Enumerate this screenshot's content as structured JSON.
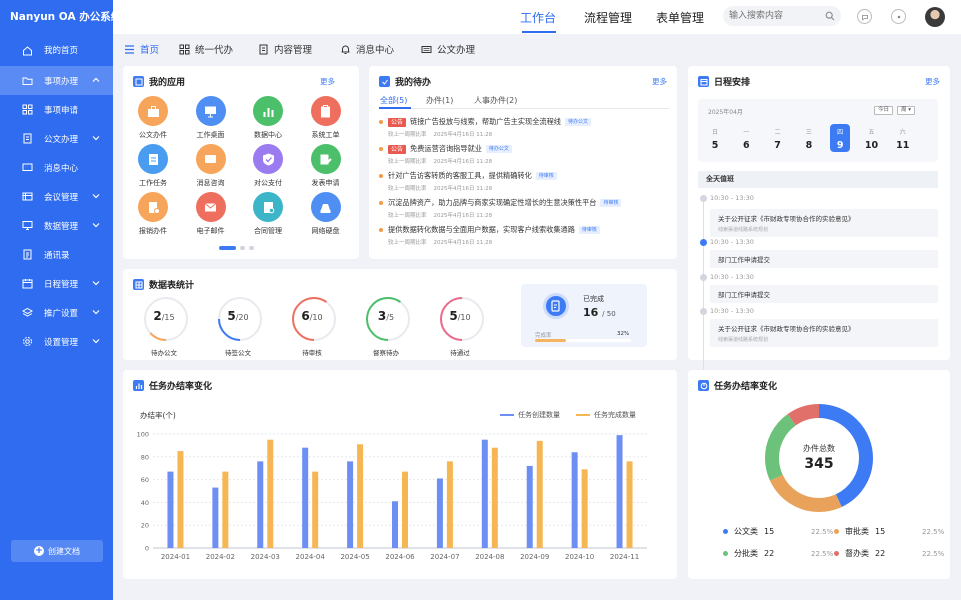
{
  "app": {
    "logo": "Nanyun OA 办公系统"
  },
  "sidebar": {
    "items": [
      {
        "label": "我的首页",
        "icon": "home-icon"
      },
      {
        "label": "事项办理",
        "icon": "folder-icon",
        "expanded": true
      },
      {
        "label": "事项申请",
        "icon": "grid-icon"
      },
      {
        "label": "公文办理",
        "icon": "document-icon"
      },
      {
        "label": "消息中心",
        "icon": "message-icon"
      },
      {
        "label": "会议管理",
        "icon": "meeting-icon"
      },
      {
        "label": "数据管理",
        "icon": "monitor-icon"
      },
      {
        "label": "通讯录",
        "icon": "contacts-icon"
      },
      {
        "label": "日程管理",
        "icon": "calendar-icon"
      },
      {
        "label": "推广设置",
        "icon": "layers-icon"
      },
      {
        "label": "设置管理",
        "icon": "settings-icon"
      }
    ],
    "create_label": "创建文档"
  },
  "topbar": {
    "tabs": [
      "工作台",
      "流程管理",
      "表单管理"
    ],
    "active_tab": 0,
    "search_placeholder": "输入搜索内容"
  },
  "subnav": {
    "items": [
      "首页",
      "统一代办",
      "内容管理",
      "消息中心",
      "公文办理"
    ],
    "active": 0
  },
  "my_apps": {
    "title": "我的应用",
    "more": "更多",
    "apps": [
      {
        "label": "公文办件",
        "color": "#f6a55a",
        "icon": "briefcase-icon"
      },
      {
        "label": "工作桌面",
        "color": "#4f8ef2",
        "icon": "desktop-icon"
      },
      {
        "label": "数据中心",
        "color": "#4cbf6a",
        "icon": "chart-icon"
      },
      {
        "label": "系统工单",
        "color": "#ef6f5e",
        "icon": "clipboard-icon"
      },
      {
        "label": "工作任务",
        "color": "#4a9cf0",
        "icon": "task-icon"
      },
      {
        "label": "消息咨询",
        "color": "#f6a55a",
        "icon": "chat-icon"
      },
      {
        "label": "对公支付",
        "color": "#9b7bf0",
        "icon": "shield-icon"
      },
      {
        "label": "发表申请",
        "color": "#4cbf6a",
        "icon": "edit-icon"
      },
      {
        "label": "报销办件",
        "color": "#f6a55a",
        "icon": "receipt-icon"
      },
      {
        "label": "电子邮件",
        "color": "#ef6f5e",
        "icon": "mail-icon"
      },
      {
        "label": "合同管理",
        "color": "#3cb5c9",
        "icon": "contract-icon"
      },
      {
        "label": "网络硬盘",
        "color": "#4f8ef2",
        "icon": "disk-icon"
      }
    ]
  },
  "todos": {
    "title": "我的待办",
    "more": "更多",
    "tabs": [
      "全部(5)",
      "办件(1)",
      "人事办件(2)"
    ],
    "items": [
      {
        "tag": "公告",
        "text": "链接广告投放与线索，帮助广告主实现全流程线",
        "badge": "待办公文",
        "meta": "较上一周期比率",
        "date": "2025年4月16日  11:28"
      },
      {
        "tag": "公告",
        "text": "免费运营咨询指导就业",
        "badge": "待办公文",
        "meta": "较上一周期比率",
        "date": "2025年4月16日  11:28"
      },
      {
        "tag": "",
        "text": "针对广告访客转质的客服工具，提供精确转化",
        "badge": "待审核",
        "meta": "较上一周期比率",
        "date": "2025年4月16日  11:28"
      },
      {
        "tag": "",
        "text": "沉淀品牌资产，助力品牌与商家实现确定性增长的生意决策性平台",
        "badge": "待审核",
        "meta": "较上一周期比率",
        "date": "2025年4月16日  11:28"
      },
      {
        "tag": "",
        "text": "提供数据转化数据与全面用户数据，实现客户线索收集通路",
        "badge": "待审核",
        "meta": "较上一周期比率",
        "date": "2025年4月16日  11:28"
      }
    ]
  },
  "schedule": {
    "title": "日程安排",
    "more": "更多",
    "month": "2025年04月",
    "today_btn": "今日",
    "view_btn": "周",
    "days": [
      {
        "w": "日",
        "d": "5"
      },
      {
        "w": "一",
        "d": "6"
      },
      {
        "w": "二",
        "d": "7"
      },
      {
        "w": "三",
        "d": "8"
      },
      {
        "w": "四",
        "d": "9",
        "selected": true
      },
      {
        "w": "五",
        "d": "10"
      },
      {
        "w": "六",
        "d": "11"
      }
    ],
    "all_day": "全天值班",
    "events": [
      {
        "time": "10:30 - 13:30",
        "title": "",
        "sub": ""
      },
      {
        "time": "",
        "title": "关于公开征求《市财政专项协合作的实验意见》",
        "sub": "线索渠道线路系统规划"
      },
      {
        "time": "10:30 - 13:30",
        "title": "",
        "sub": ""
      },
      {
        "time": "",
        "title": "部门工作申请提交",
        "sub": ""
      },
      {
        "time": "10:30 - 13:30",
        "title": "",
        "sub": ""
      },
      {
        "time": "",
        "title": "部门工作申请提交",
        "sub": ""
      },
      {
        "time": "10:30 - 13:30",
        "title": "",
        "sub": ""
      },
      {
        "time": "",
        "title": "关于公开征求《市财政专项协合作的实验意见》",
        "sub": "线索渠道线路系统规划"
      }
    ]
  },
  "stats": {
    "title": "数据表统计",
    "items": [
      {
        "value": "2",
        "total": "/15",
        "label": "待办公文",
        "frac": 0.133,
        "color": "#f6a55a"
      },
      {
        "value": "5",
        "total": "/20",
        "label": "待签公文",
        "frac": 0.25,
        "color": "#3d7bf5"
      },
      {
        "value": "6",
        "total": "/10",
        "label": "待审核",
        "frac": 0.6,
        "color": "#ef6f5e"
      },
      {
        "value": "3",
        "total": "/5",
        "label": "督察待办",
        "frac": 0.6,
        "color": "#4cbf6a"
      },
      {
        "value": "5",
        "total": "/10",
        "label": "待通过",
        "frac": 0.5,
        "color": "#e96b8c"
      }
    ],
    "done": {
      "label": "已完成",
      "value": "16",
      "total": "/ 50",
      "progress_label": "完成率",
      "percent_text": "32%",
      "percent": 0.32
    }
  },
  "task_chart": {
    "title": "任务办结率变化",
    "legend": [
      "任务创建数量",
      "任务完成数量"
    ],
    "colors": [
      "#6d8ff3",
      "#f6b653"
    ]
  },
  "chart_data": {
    "type": "bar",
    "ylabel": "办结率(个)",
    "ylim": [
      0,
      100
    ],
    "yticks": [
      0,
      20,
      40,
      60,
      80,
      100
    ],
    "categories": [
      "2024-01",
      "2024-02",
      "2024-03",
      "2024-04",
      "2024-05",
      "2024-06",
      "2024-07",
      "2024-08",
      "2024-09",
      "2024-10",
      "2024-11"
    ],
    "series": [
      {
        "name": "任务创建数量",
        "values": [
          67,
          53,
          76,
          88,
          76,
          41,
          61,
          95,
          72,
          84,
          99
        ]
      },
      {
        "name": "任务完成数量",
        "values": [
          85,
          67,
          95,
          67,
          91,
          67,
          76,
          88,
          94,
          69,
          76
        ]
      }
    ]
  },
  "pie_card": {
    "title": "任务办结率变化",
    "center_label": "办件总数",
    "center_value": "345",
    "legend": [
      {
        "name": "公文类",
        "value": "15",
        "pct": "22.5%",
        "color": "#3d7bf5"
      },
      {
        "name": "审批类",
        "value": "15",
        "pct": "22.5%",
        "color": "#e8a25a"
      },
      {
        "name": "分批类",
        "value": "22",
        "pct": "22.5%",
        "color": "#6cc27a"
      },
      {
        "name": "督办类",
        "value": "22",
        "pct": "22.5%",
        "color": "#e2706a"
      }
    ],
    "segments": [
      {
        "color": "#3d7bf5",
        "frac": 0.43
      },
      {
        "color": "#e8a25a",
        "frac": 0.25
      },
      {
        "color": "#6cc27a",
        "frac": 0.22
      },
      {
        "color": "#e2706a",
        "frac": 0.1
      }
    ]
  }
}
